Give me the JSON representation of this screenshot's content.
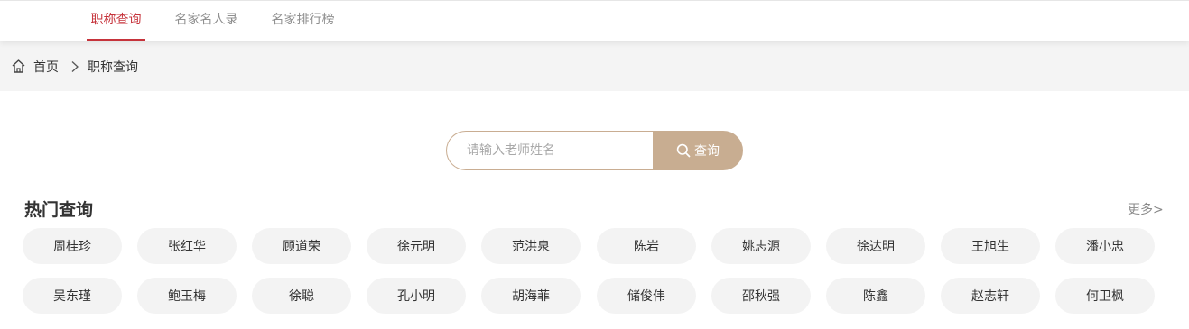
{
  "nav": {
    "tabs": [
      {
        "label": "职称查询",
        "active": true
      },
      {
        "label": "名家名人录",
        "active": false
      },
      {
        "label": "名家排行榜",
        "active": false
      }
    ]
  },
  "breadcrumb": {
    "home_icon": "home-icon",
    "home": "首页",
    "separator_icon": "chevron-right-icon",
    "current": "职称查询"
  },
  "search": {
    "placeholder": "请输入老师姓名",
    "value": "",
    "button_icon": "search-icon",
    "button_label": "查询"
  },
  "hot": {
    "title": "热门查询",
    "more": "更多>",
    "names": [
      "周桂珍",
      "张红华",
      "顾道荣",
      "徐元明",
      "范洪泉",
      "陈岩",
      "姚志源",
      "徐达明",
      "王旭生",
      "潘小忠",
      "吴东瑾",
      "鲍玉梅",
      "徐聪",
      "孔小明",
      "胡海菲",
      "储俊伟",
      "邵秋强",
      "陈鑫",
      "赵志轩",
      "何卫枫"
    ]
  },
  "colors": {
    "accent_red": "#c6333b",
    "search_button": "#c8ad91",
    "chip_bg": "#f3f3f3",
    "breadcrumb_bg": "#f4f4f4"
  }
}
